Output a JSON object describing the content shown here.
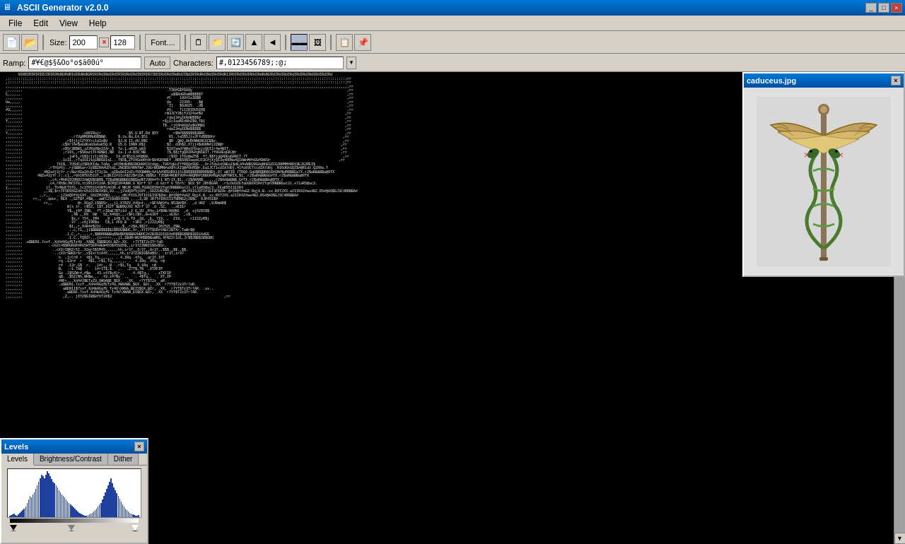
{
  "titleBar": {
    "title": "ASCII Generator v2.0.0",
    "icon": "🖥",
    "buttons": [
      "_",
      "□",
      "×"
    ]
  },
  "menuBar": {
    "items": [
      "File",
      "Edit",
      "View",
      "Help"
    ]
  },
  "toolbar": {
    "sizeLabel": "Size:",
    "sizeValue": "200",
    "heightValue": "128",
    "fontLabel": "Font....",
    "buttons": [
      "new",
      "open",
      "save",
      "undo",
      "redo",
      "flip-h",
      "flip-v",
      "rotate-l",
      "rotate-r",
      "view-text",
      "view-image",
      "copy",
      "paste"
    ]
  },
  "ramp": {
    "label": "Ramp:",
    "value": "#¥€@$§&Oo°o$ã00ú°",
    "autoLabel": "Auto",
    "charsLabel": "Characters:",
    "charsValue": "#,0123456789;:@;"
  },
  "levelsPanel": {
    "title": "Levels",
    "tabs": [
      "Levels",
      "Brightness/Contrast",
      "Dither"
    ],
    "activeTab": "Levels",
    "histogramBars": [
      2,
      3,
      4,
      5,
      3,
      2,
      4,
      6,
      8,
      10,
      12,
      15,
      20,
      25,
      30,
      28,
      32,
      35,
      40,
      45,
      50,
      55,
      60,
      58,
      55,
      60,
      65,
      62,
      58,
      54,
      50,
      48,
      45,
      42,
      38,
      35,
      32,
      30,
      28,
      25,
      22,
      20,
      18,
      16,
      14,
      12,
      10,
      8,
      6,
      5,
      4,
      3,
      2,
      2,
      3,
      4,
      5,
      6,
      8,
      10,
      12,
      15,
      18,
      20,
      25,
      30,
      35,
      40,
      45,
      50,
      55,
      48,
      42,
      38,
      34,
      30,
      26,
      22,
      18,
      15,
      12,
      10,
      8,
      6,
      5,
      4,
      3,
      2,
      2,
      3
    ]
  },
  "previewWindow": {
    "title": "caduceus.jpg",
    "imageAlt": "Caduceus medical symbol"
  },
  "asciiContent": {
    "placeholder": "ASCII art content"
  }
}
